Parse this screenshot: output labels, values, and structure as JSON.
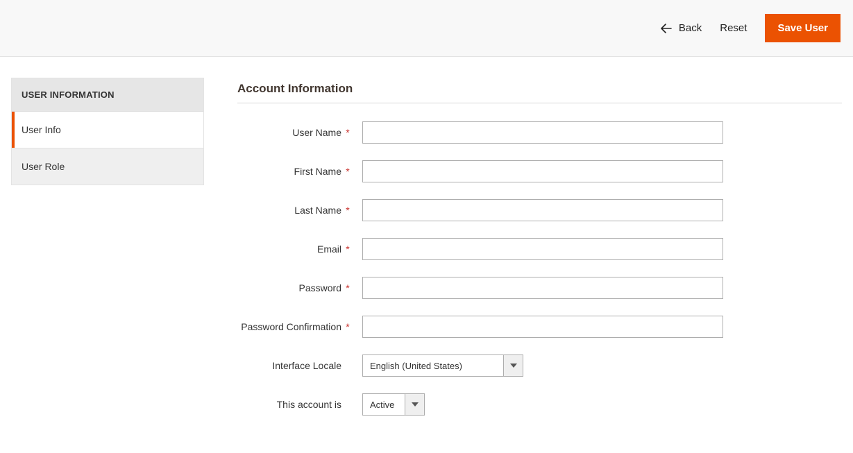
{
  "header": {
    "back_label": "Back",
    "reset_label": "Reset",
    "save_label": "Save User"
  },
  "sidebar": {
    "title": "USER INFORMATION",
    "items": [
      {
        "label": "User Info",
        "active": true
      },
      {
        "label": "User Role",
        "active": false
      }
    ]
  },
  "section": {
    "title": "Account Information"
  },
  "fields": {
    "user_name": {
      "label": "User Name",
      "required": true,
      "value": ""
    },
    "first_name": {
      "label": "First Name",
      "required": true,
      "value": ""
    },
    "last_name": {
      "label": "Last Name",
      "required": true,
      "value": ""
    },
    "email": {
      "label": "Email",
      "required": true,
      "value": ""
    },
    "password": {
      "label": "Password",
      "required": true,
      "value": ""
    },
    "password_confirmation": {
      "label": "Password Confirmation",
      "required": true,
      "value": ""
    },
    "interface_locale": {
      "label": "Interface Locale",
      "required": false,
      "value": "English (United States)"
    },
    "account_status": {
      "label": "This account is",
      "required": false,
      "value": "Active"
    }
  }
}
